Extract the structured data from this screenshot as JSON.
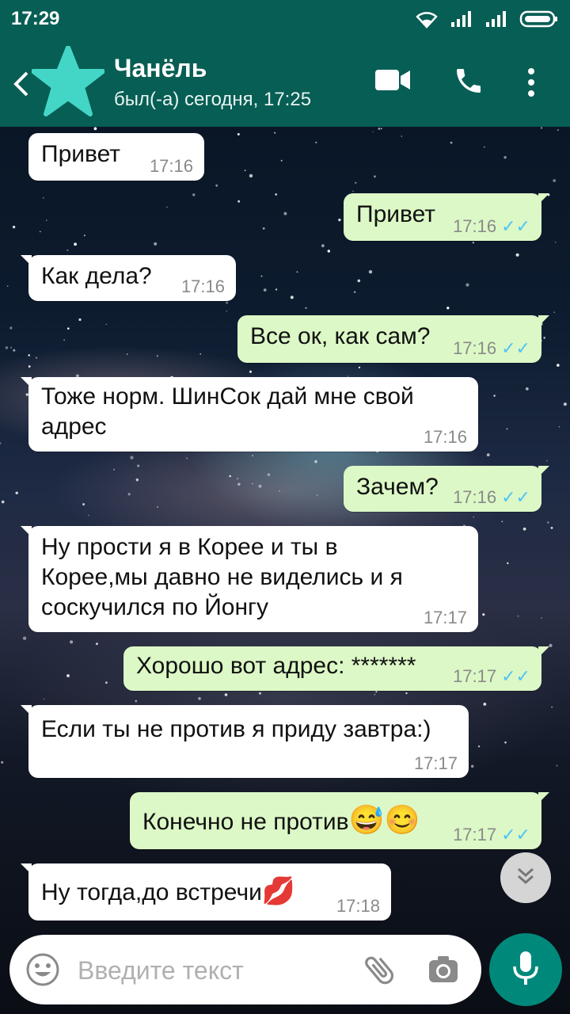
{
  "status_bar": {
    "time": "17:29"
  },
  "header": {
    "contact_name": "Чанёль",
    "last_seen": "был(-а) сегодня, 17:25"
  },
  "messages": [
    {
      "dir": "in",
      "text": "Привет",
      "time": "17:16"
    },
    {
      "dir": "out",
      "text": "Привет",
      "time": "17:16"
    },
    {
      "dir": "in",
      "text": "Как дела?",
      "time": "17:16"
    },
    {
      "dir": "out",
      "text": "Все ок, как сам?",
      "time": "17:16"
    },
    {
      "dir": "in",
      "text_lines": [
        "Тоже норм. ШинСок дай мне свой",
        "адрес"
      ],
      "time": "17:16"
    },
    {
      "dir": "out",
      "text": "Зачем?",
      "time": "17:16"
    },
    {
      "dir": "in",
      "text_lines": [
        "Ну прости я в Корее и ты в",
        "Корее,мы давно не виделись и я",
        "соскучился по Йонгу"
      ],
      "time": "17:17"
    },
    {
      "dir": "out",
      "text": "Хорошо вот адрес: *******",
      "time": "17:17"
    },
    {
      "dir": "in",
      "text": "Если ты не против я приду завтра:)",
      "time": "17:17"
    },
    {
      "dir": "out",
      "text": "Конечно не против",
      "emoji": "😅😊",
      "time": "17:17"
    },
    {
      "dir": "in",
      "text": "Ну тогда,до встречи",
      "emoji": "💋",
      "time": "17:18"
    }
  ],
  "input": {
    "placeholder": "Введите текст"
  },
  "colors": {
    "header": "#075e54",
    "outgoing": "#dcf8c6",
    "incoming": "#ffffff",
    "mic": "#00897b",
    "ticks": "#4fc3f7"
  },
  "icons": [
    "back-arrow-icon",
    "video-call-icon",
    "phone-icon",
    "more-vert-icon",
    "emoji-icon",
    "attach-icon",
    "camera-icon",
    "mic-icon",
    "scroll-down-icon",
    "wifi-icon",
    "signal-icon",
    "battery-icon"
  ]
}
